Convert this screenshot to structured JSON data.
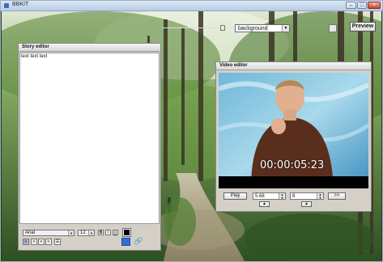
{
  "window": {
    "title": "BBKIT"
  },
  "toolbar": {
    "background_select": {
      "value": "background"
    },
    "preview_label": "Preview"
  },
  "story_editor": {
    "title": "Story editor",
    "text": "text text text",
    "font_select": "Arial",
    "size_select": "12",
    "format_buttons": [
      "B",
      "I",
      "U"
    ]
  },
  "video_editor": {
    "title": "Video editor",
    "timecode": "00:00:05:23",
    "play_label": "Play",
    "start_value": "5.68",
    "end_value": "8",
    "next_label": ">>"
  },
  "colors": {
    "accent_blue": "#2f6fd0",
    "panel": "#d4d0c8"
  }
}
